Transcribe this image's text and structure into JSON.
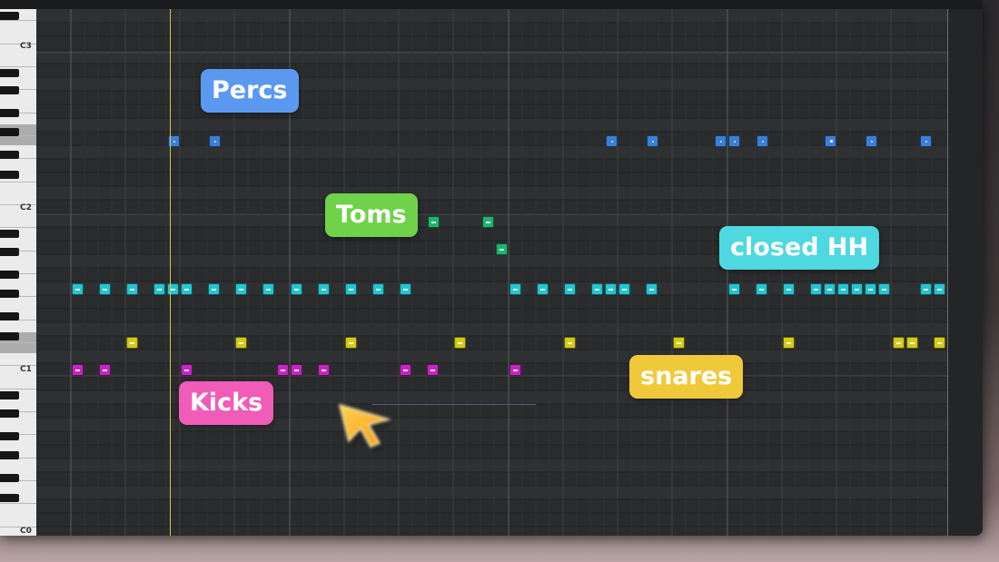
{
  "piano_roll": {
    "octave_labels": {
      "c3": "C3",
      "c2": "C2",
      "c1": "C1",
      "c0": "C0"
    },
    "colors": {
      "percs": "#3b7fd6",
      "toms": "#1fb36f",
      "closed_hh": "#25c4cf",
      "snares": "#d1cb17",
      "kicks": "#c427c1",
      "playhead": "#d2c54a"
    }
  },
  "labels": {
    "percs": {
      "text": "Percs",
      "color": "#5b99f0"
    },
    "toms": {
      "text": "Toms",
      "color": "#6fd24a"
    },
    "closed_hh": {
      "text": "closed HH",
      "color": "#4ed8e0"
    },
    "snares": {
      "text": "snares",
      "color": "#f0c93a"
    },
    "kicks": {
      "text": "Kicks",
      "color": "#f05cb8"
    }
  },
  "cursor": {
    "icon": "mouse-pointer-icon"
  }
}
